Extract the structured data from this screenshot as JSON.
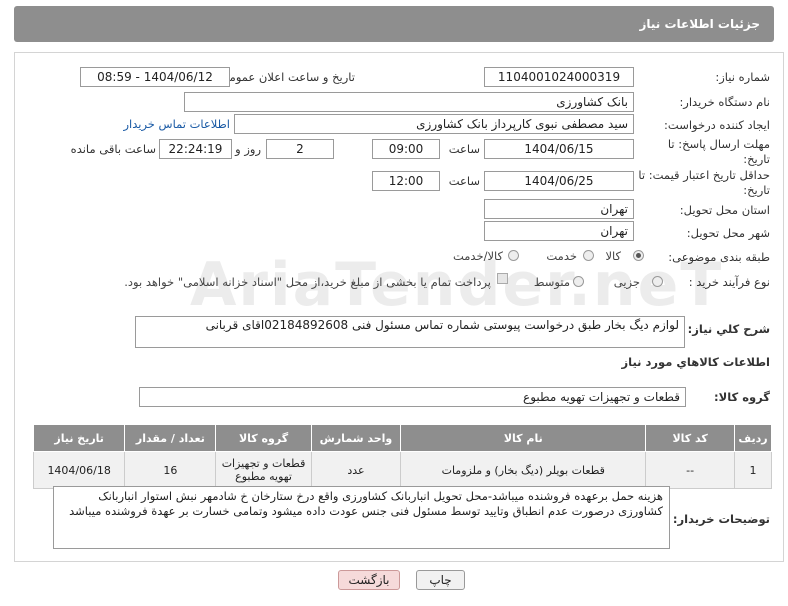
{
  "header": {
    "title": "جزئیات اطلاعات نیاز"
  },
  "fields": {
    "need_number": {
      "label": "شماره نیاز:",
      "value": "1104001024000319"
    },
    "announce_datetime": {
      "label": "تاریخ و ساعت اعلان عمومی:",
      "value": "1404/06/12 - 08:59"
    },
    "buyer_org": {
      "label": "نام دستگاه خریدار:",
      "value": "بانک کشاورزی"
    },
    "requester": {
      "label": "ایجاد کننده درخواست:",
      "value": "سید مصطفی نبوی کارپرداز بانک کشاورزی",
      "link": "اطلاعات تماس خریدار"
    },
    "response_deadline": {
      "label": "مهلت ارسال پاسخ: تا تاریخ:",
      "date": "1404/06/15",
      "time_label": "ساعت",
      "time": "09:00",
      "days": "2",
      "days_label": "روز و",
      "remaining": "22:24:19",
      "remaining_label": "ساعت باقی مانده"
    },
    "price_validity": {
      "label": "حداقل تاریخ اعتبار قیمت: تا تاریخ:",
      "date": "1404/06/25",
      "time_label": "ساعت",
      "time": "12:00"
    },
    "province": {
      "label": "استان محل تحویل:",
      "value": "تهران"
    },
    "city": {
      "label": "شهر محل تحویل:",
      "value": "تهران"
    },
    "category": {
      "label": "طبقه بندی موضوعی:",
      "options": [
        "کالا",
        "خدمت",
        "کالا/خدمت"
      ],
      "selected": "کالا"
    },
    "process_type": {
      "label": "نوع فرآیند خرید :",
      "options": [
        "جزیی",
        "متوسط"
      ],
      "note": "پرداخت تمام یا بخشی از مبلغ خرید،از محل \"اسناد خزانه اسلامی\" خواهد بود."
    }
  },
  "description": {
    "label": "شرح كلي نياز:",
    "value": "لوازم دیگ بخار طبق درخواست پیوستی شماره تماس مسئول فنی 02184892608اقای قربانی"
  },
  "goods_info": {
    "title": "اطلاعات كالاهاي مورد نياز"
  },
  "goods_group": {
    "label": "گروه کالا:",
    "value": "قطعات و تجهیزات تهویه مطبوع"
  },
  "table": {
    "headers": [
      "ردیف",
      "کد کالا",
      "نام کالا",
      "واحد شمارش",
      "گروه کالا",
      "تعداد / مقدار",
      "تاریخ نیاز"
    ],
    "rows": [
      [
        "1",
        "--",
        "قطعات بویلر (دیگ بخار) و ملزومات",
        "عدد",
        "قطعات و تجهیزات تهویه مطبوع",
        "16",
        "1404/06/18"
      ]
    ]
  },
  "buyer_notes": {
    "label": "توضیحات خریدار:",
    "value": "هزینه حمل برعهده فروشنده میباشد-محل تحویل انباربانک کشاورزی واقع درخ ستارخان خ شادمهر نبش استوار انباربانک کشاورزی درصورت عدم انطباق وتایید توسط مسئول فنی جنس عودت داده میشود وتمامی خسارت بر عهدة فروشنده میباشد"
  },
  "buttons": {
    "print": "چاپ",
    "back": "بازگشت"
  },
  "watermark": "AriaTender.neT"
}
